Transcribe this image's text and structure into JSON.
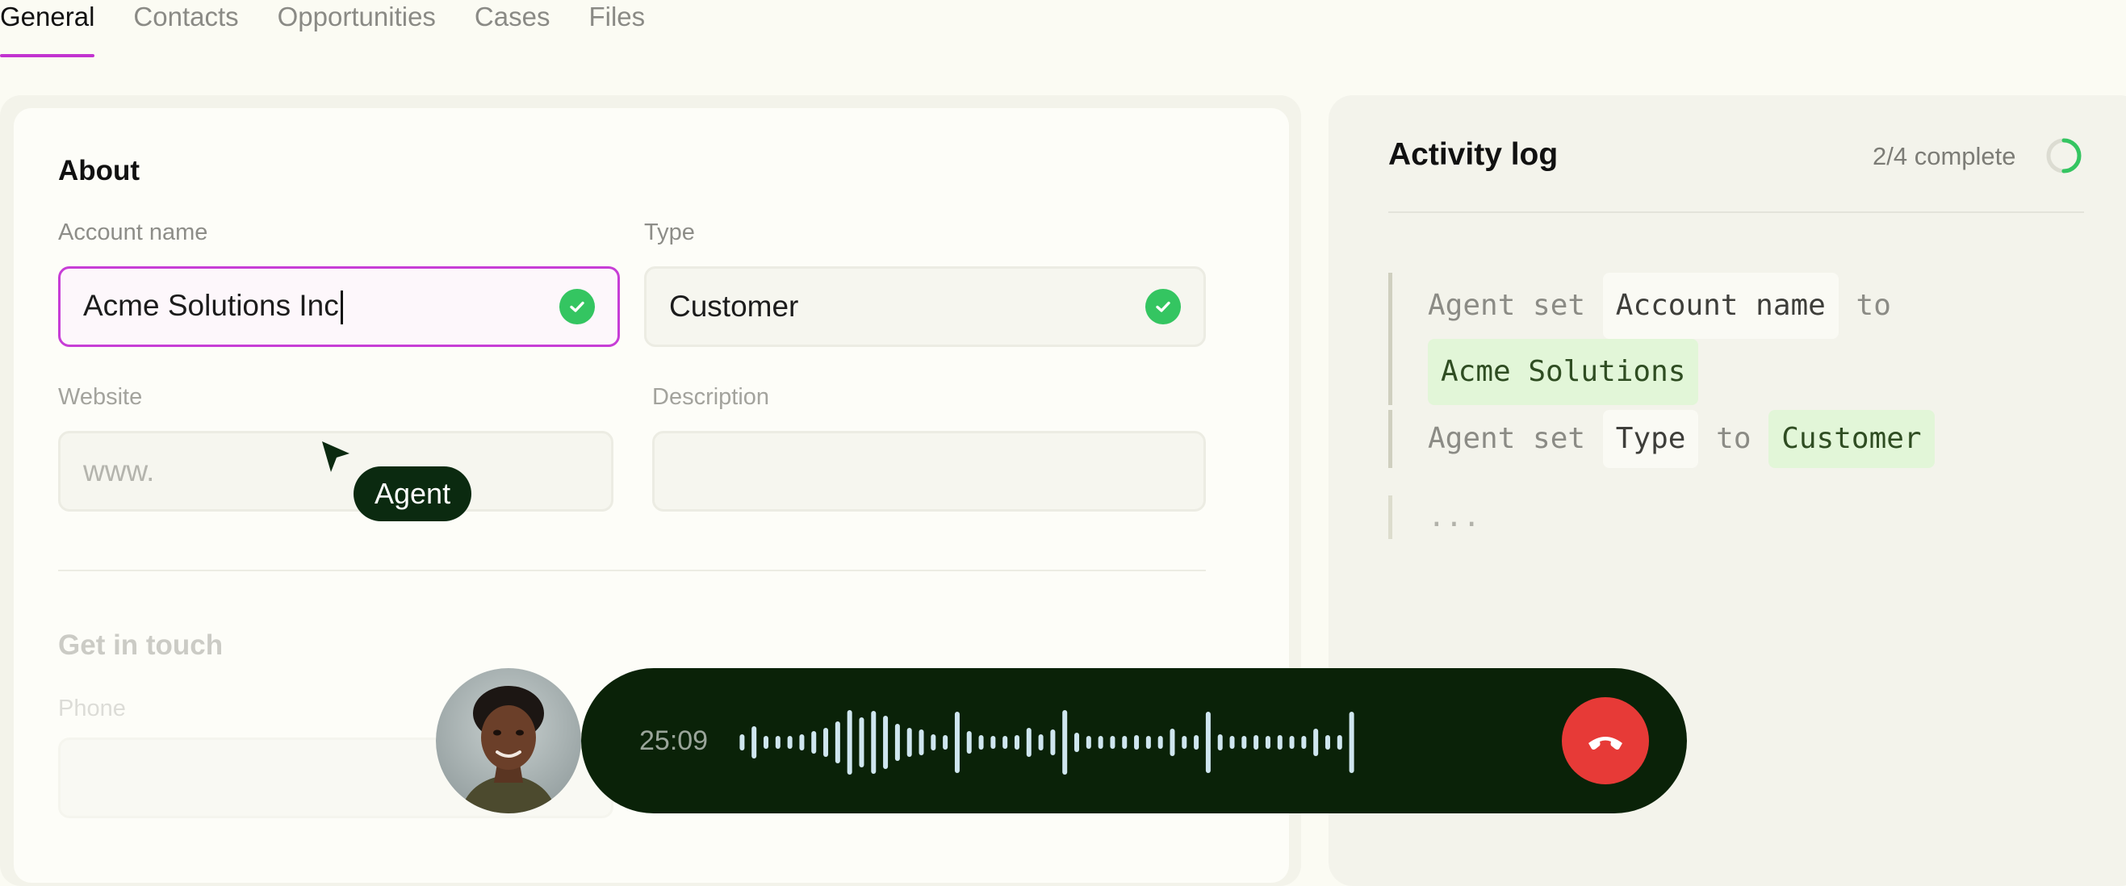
{
  "tabs": [
    {
      "label": "General",
      "active": true
    },
    {
      "label": "Contacts",
      "active": false
    },
    {
      "label": "Opportunities",
      "active": false
    },
    {
      "label": "Cases",
      "active": false
    },
    {
      "label": "Files",
      "active": false
    }
  ],
  "about": {
    "title": "About",
    "account_name": {
      "label": "Account name",
      "value": "Acme Solutions Inc",
      "status": "check-icon"
    },
    "type": {
      "label": "Type",
      "value": "Customer",
      "status": "check-icon"
    },
    "website": {
      "label": "Website",
      "placeholder": "www."
    },
    "description": {
      "label": "Description",
      "value": ""
    }
  },
  "contact": {
    "title": "Get in touch",
    "phone_label": "Phone"
  },
  "agent_cursor": {
    "label": "Agent"
  },
  "activity_log": {
    "title": "Activity log",
    "progress_text": "2/4 complete",
    "progress_fraction": 0.5,
    "entries": [
      {
        "prefix": "Agent set",
        "field": "Account name",
        "connector": "to",
        "value": "Acme Solutions"
      },
      {
        "prefix": "Agent set",
        "field": "Type",
        "connector": "to",
        "value": "Customer"
      }
    ],
    "pending": "..."
  },
  "call": {
    "timer": "25:09",
    "hangup_icon": "phone-hangup-icon",
    "avatar_icon": "caller-avatar"
  },
  "colors": {
    "accent": "#c233d0",
    "success": "#34c561",
    "call_bg": "#0a2208",
    "hangup": "#e73a37",
    "highlight_green": "#e2f6d8"
  }
}
